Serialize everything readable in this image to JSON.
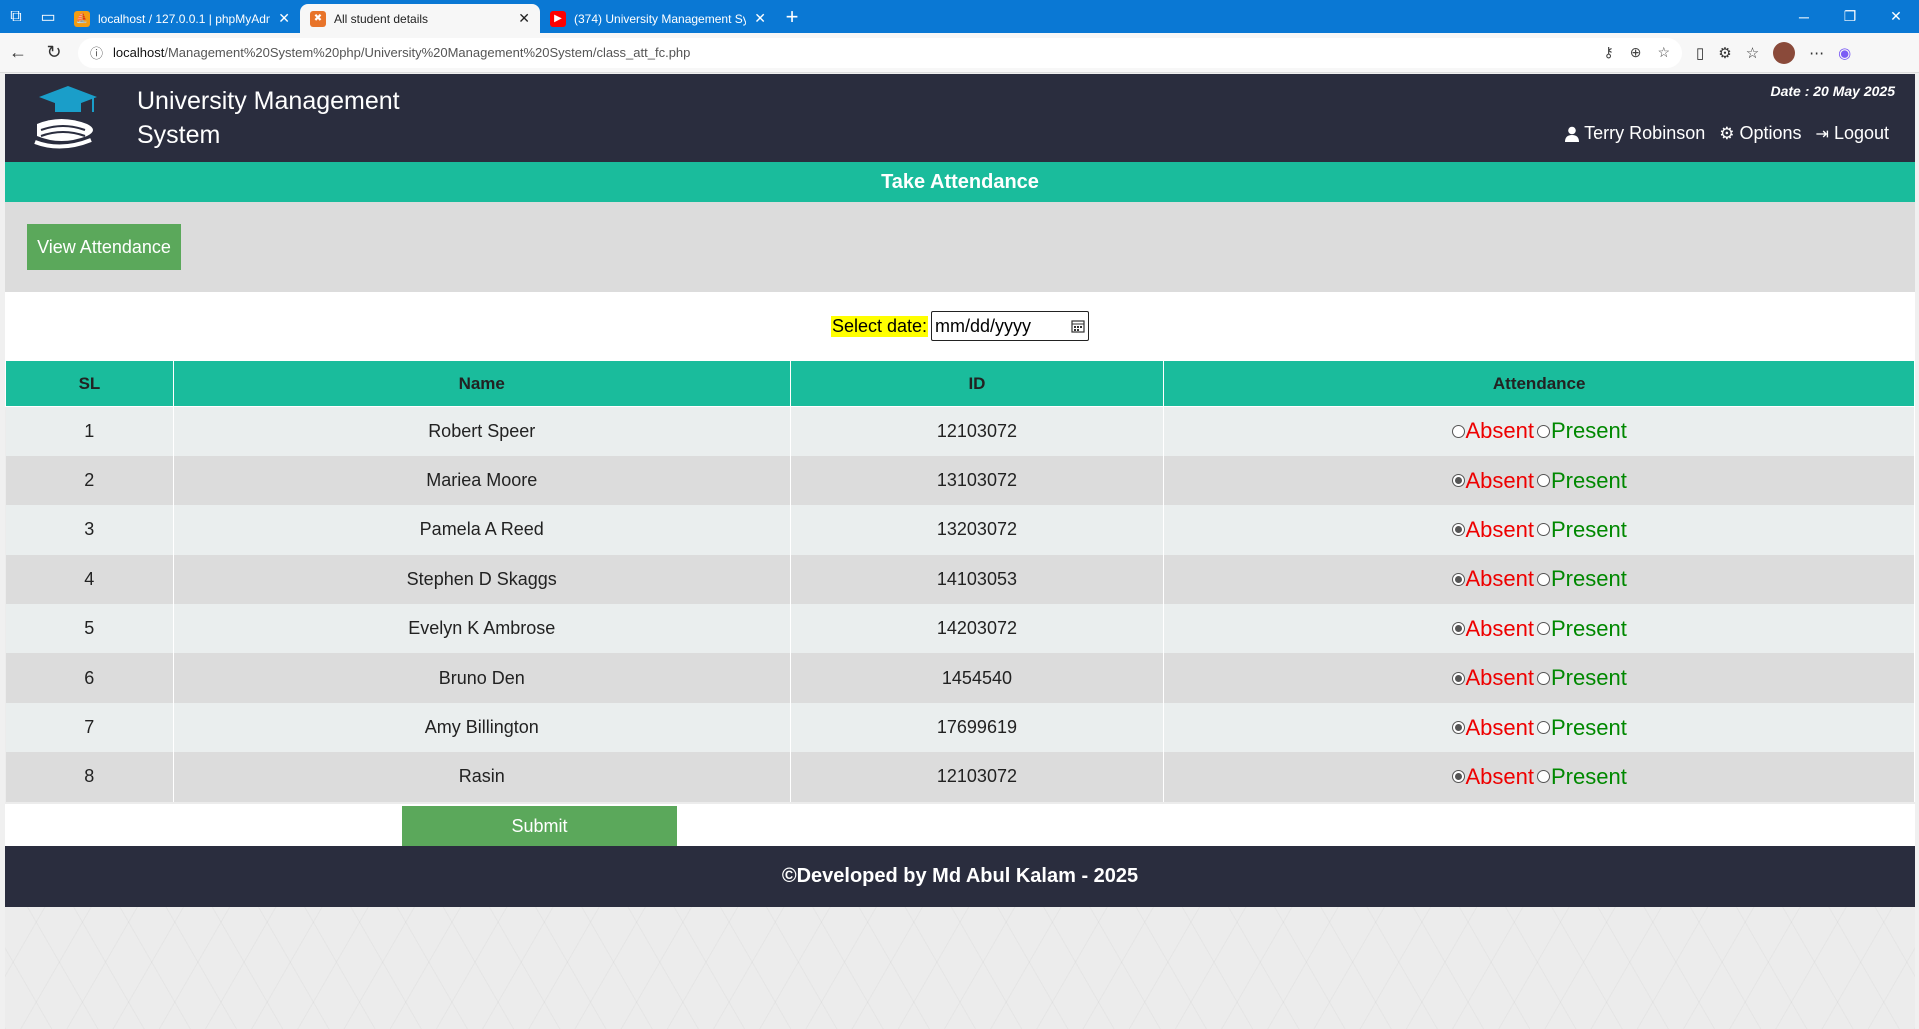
{
  "browser": {
    "tabs": [
      {
        "title": "localhost / 127.0.0.1 | phpMyAdm",
        "active": false
      },
      {
        "title": "All student details",
        "active": true
      },
      {
        "title": "(374) University Management Sys",
        "active": false
      }
    ],
    "url_host": "localhost",
    "url_path": "/Management%20System%20php/University%20Management%20System/class_att_fc.php"
  },
  "header": {
    "app_title": "University Management System",
    "date": "Date : 20 May 2025",
    "user": "Terry Robinson",
    "options": "Options",
    "logout": "Logout"
  },
  "page_title": "Take Attendance",
  "view_attendance_label": "View Attendance",
  "date_select": {
    "label": "Select date:",
    "placeholder": "mm/dd/yyyy"
  },
  "table": {
    "headers": [
      "SL",
      "Name",
      "ID",
      "Attendance"
    ],
    "absent_label": "Absent",
    "present_label": "Present",
    "rows": [
      {
        "sl": "1",
        "name": "Robert Speer",
        "id": "12103072",
        "absent_checked": false
      },
      {
        "sl": "2",
        "name": "Mariea Moore",
        "id": "13103072",
        "absent_checked": true
      },
      {
        "sl": "3",
        "name": "Pamela A Reed",
        "id": "13203072",
        "absent_checked": true
      },
      {
        "sl": "4",
        "name": "Stephen D Skaggs",
        "id": "14103053",
        "absent_checked": true
      },
      {
        "sl": "5",
        "name": "Evelyn K Ambrose",
        "id": "14203072",
        "absent_checked": true
      },
      {
        "sl": "6",
        "name": "Bruno Den",
        "id": "1454540",
        "absent_checked": true
      },
      {
        "sl": "7",
        "name": "Amy Billington",
        "id": "17699619",
        "absent_checked": true
      },
      {
        "sl": "8",
        "name": "Rasin",
        "id": "12103072",
        "absent_checked": true
      }
    ]
  },
  "submit_label": "Submit",
  "footer": "©Developed by Md Abul Kalam - 2025"
}
